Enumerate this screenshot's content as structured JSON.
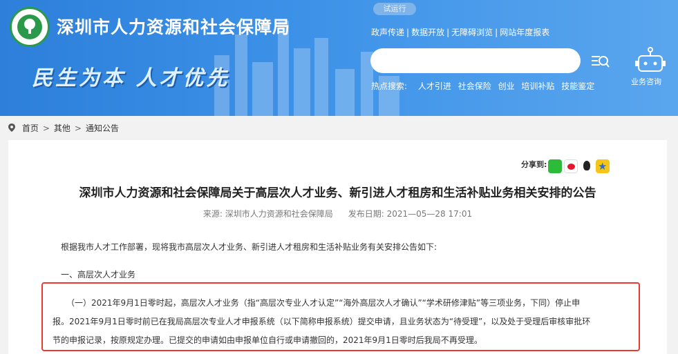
{
  "header": {
    "site_title": "深圳市人力资源和社会保障局",
    "slogan": "民生为本  人才优先",
    "trial_badge": "试运行",
    "top_links": [
      "政声传递",
      "数据开放",
      "无障碍浏览",
      "网站年度报表"
    ],
    "search": {
      "placeholder": ""
    },
    "hot_label": "热点搜索:",
    "hot_items": [
      "人才引进",
      "社会保险",
      "创业",
      "培训补贴",
      "技能鉴定"
    ],
    "service_label": "业务咨询"
  },
  "breadcrumb": {
    "items": [
      "首页",
      "其他",
      "通知公告"
    ],
    "separator": ">"
  },
  "article": {
    "share_label": "分享到:",
    "share_icons": [
      "wechat-icon",
      "weibo-icon",
      "qq-icon",
      "qzone-icon"
    ],
    "title": "深圳市人力资源和社会保障局关于高层次人才业务、新引进人才租房和生活补贴业务相关安排的公告",
    "source": "来源: 深圳市人力资源和社会保障局",
    "publish_date": "发布日期: 2021—05—28 17:01",
    "intro": "根据我市人才工作部署，现将我市高层次人才业务、新引进人才租房和生活补贴业务有关安排公告如下:",
    "section1": "一、高层次人才业务",
    "highlight_lines": [
      "（一）2021年9月1日零时起，高层次人才业务（指“高层次专业人才认定”“海外高层次人才确认”“学术研修津贴”等三项业务，下同）停止申",
      "报。2021年9月1日零时前已在我局高层次专业人才申报系统（以下简称申报系统）提交申请，且业务状态为“待受理”，以及处于受理后审核审批环",
      "节的申报记录，按原规定办理。已提交的申请如由申报单位自行或申请撤回的，2021年9月1日零时后我局不再受理。"
    ]
  },
  "colors": {
    "header_blue": "#3d92e8",
    "highlight_red": "#e63b2e",
    "logo_green": "#2a9a4a"
  }
}
